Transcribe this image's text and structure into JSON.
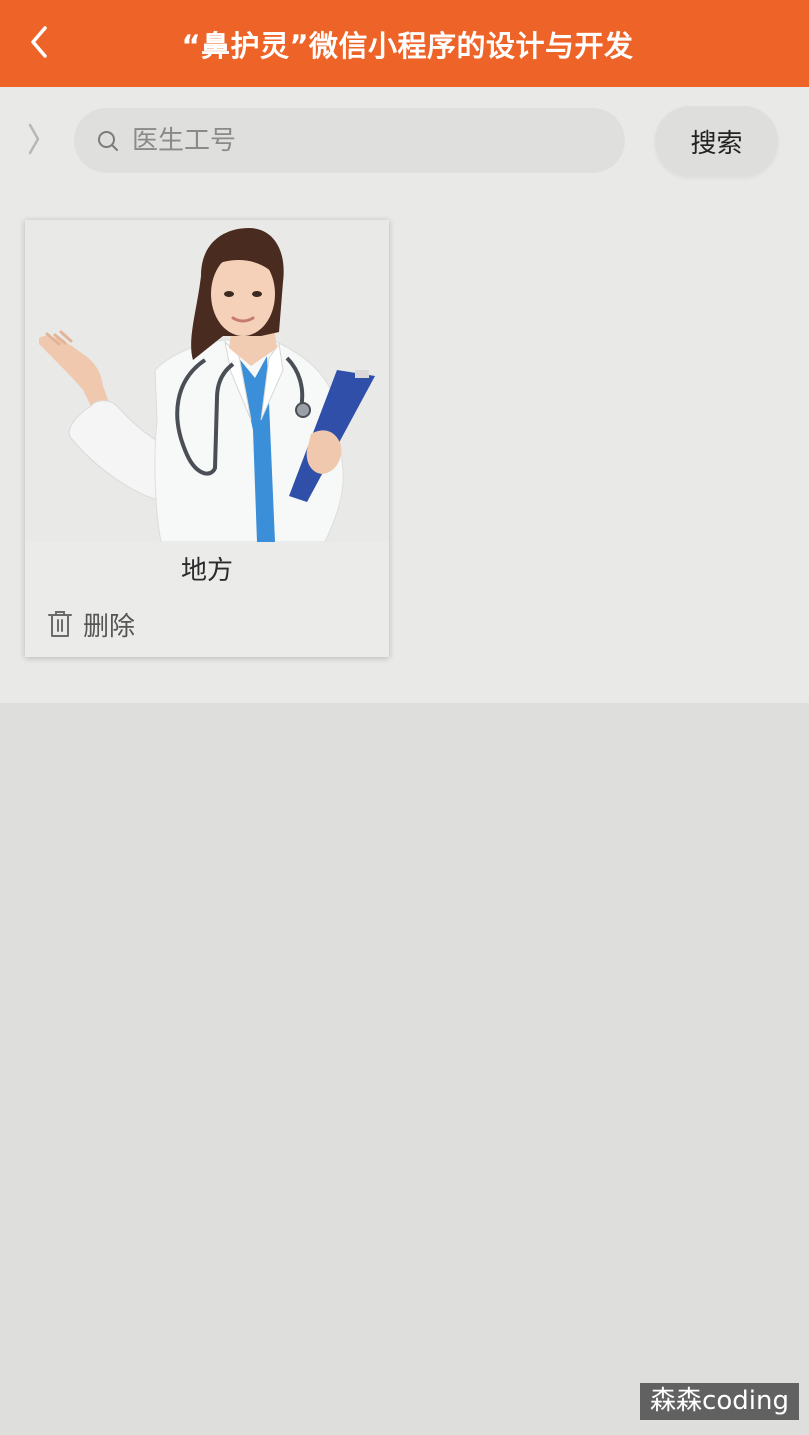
{
  "header": {
    "title": "“鼻护灵”微信小程序的设计与开发",
    "back_icon": "chevron-left-icon",
    "color": "#ee6327"
  },
  "search": {
    "placeholder": "医生工号",
    "value": "",
    "button_label": "搜索",
    "icon": "search-icon"
  },
  "side_toggle_icon": "chevron-right-icon",
  "doctors": [
    {
      "name": "地方",
      "photo": "doctor-photo",
      "delete_label": "删除",
      "delete_icon": "trash-icon"
    }
  ],
  "watermark": "森森coding"
}
